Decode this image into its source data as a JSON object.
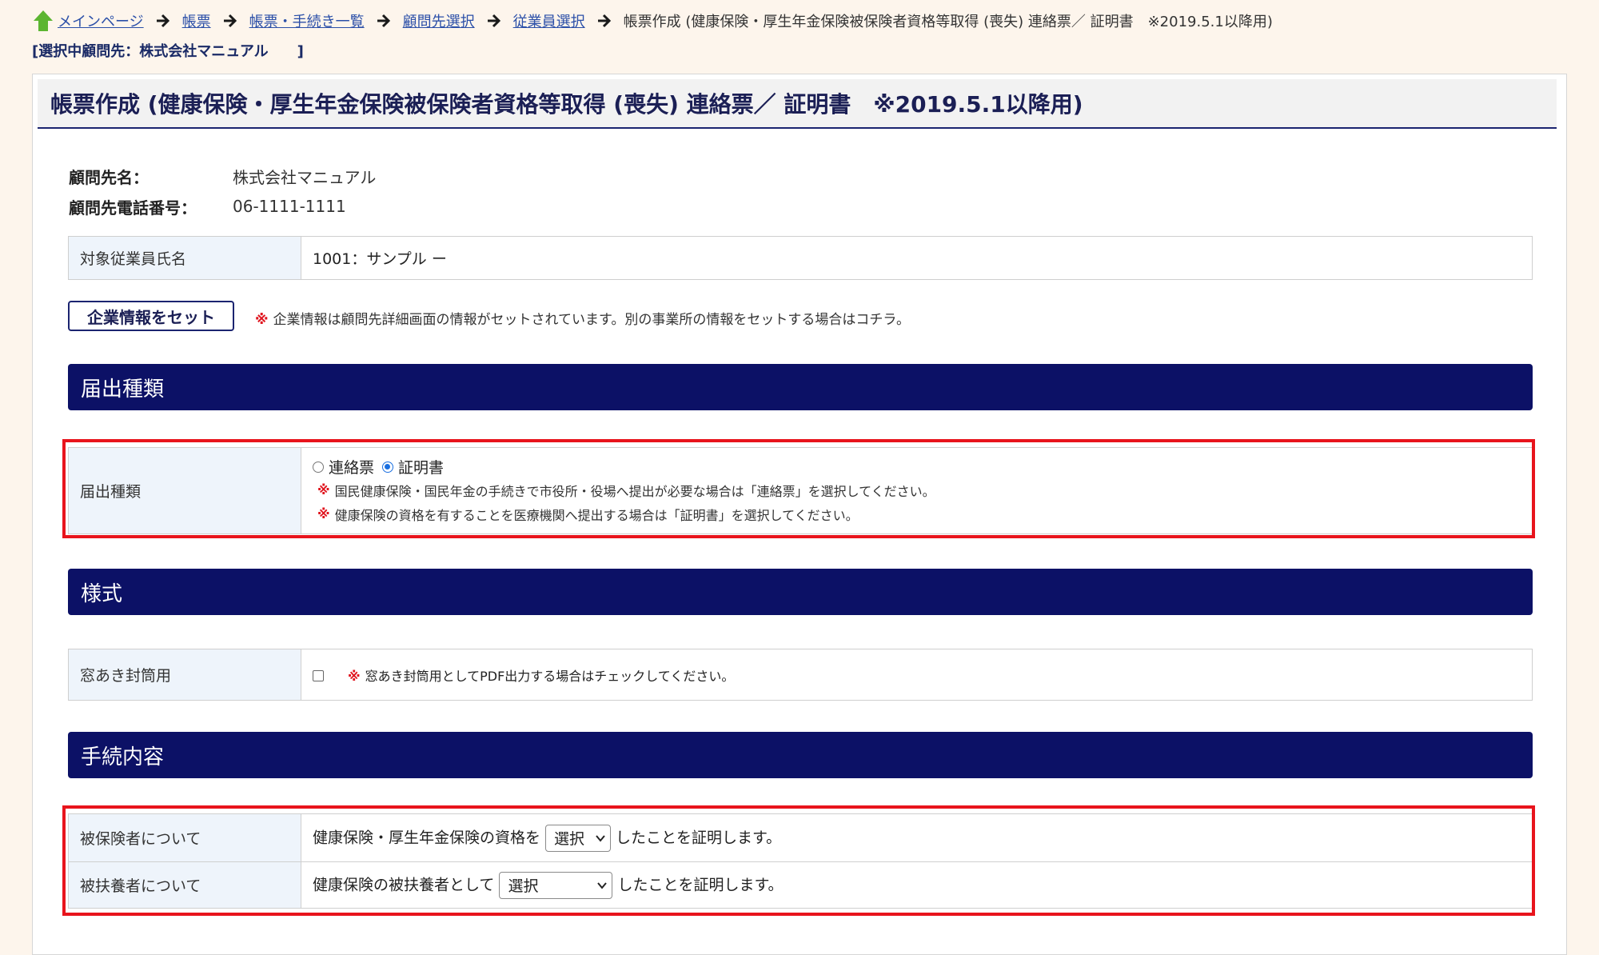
{
  "breadcrumb": {
    "items": [
      "メインページ",
      "帳票",
      "帳票・手続き一覧",
      "顧問先選択",
      "従業員選択"
    ],
    "current": "帳票作成 (健康保険・厚生年金保険被保険者資格等取得 (喪失) 連絡票／ 証明書　※2019.5.1以降用)"
  },
  "selected_client": "[選択中顧問先：株式会社マニュアル　　]",
  "page_title": "帳票作成 (健康保険・厚生年金保険被保険者資格等取得 (喪失) 連絡票／ 証明書　※2019.5.1以降用)",
  "client_info": {
    "name_label": "顧問先名：",
    "name_value": "株式会社マニュアル",
    "phone_label": "顧問先電話番号：",
    "phone_value": "06-1111-1111"
  },
  "employee": {
    "label": "対象従業員氏名",
    "value": "1001：サンプル ー"
  },
  "company_info": {
    "button_label": "企業情報をセット",
    "note_mark": "※",
    "note": "企業情報は顧問先詳細画面の情報がセットされています。別の事業所の情報をセットする場合はコチラ。"
  },
  "sections": {
    "notification_type": "届出種類",
    "format": "様式",
    "procedure": "手続内容"
  },
  "notification": {
    "label": "届出種類",
    "options": [
      "連絡票",
      "証明書"
    ],
    "selected": "証明書",
    "notes": [
      "国民健康保険・国民年金の手続きで市役所・役場へ提出が必要な場合は「連絡票」を選択してください。",
      "健康保険の資格を有することを医療機関へ提出する場合は「証明書」を選択してください。"
    ],
    "note_mark": "※"
  },
  "format": {
    "label": "窓あき封筒用",
    "checked": false,
    "note_mark": "※",
    "note": "窓あき封筒用としてPDF出力する場合はチェックしてください。"
  },
  "procedure": {
    "insured": {
      "label": "被保険者について",
      "prefix": "健康保険・厚生年金保険の資格を",
      "select_value": "選択",
      "suffix": "したことを証明します。"
    },
    "dependent": {
      "label": "被扶養者について",
      "prefix": "健康保険の被扶養者として",
      "select_value": "選択",
      "suffix": "したことを証明します。"
    }
  },
  "colors": {
    "background": "#fdf5ec",
    "section_bar": "#0c1166",
    "highlight_box": "#e8141c",
    "link": "#2b4fa8",
    "note_mark": "#e0141e",
    "label_cell": "#eef4fb"
  },
  "icons": {
    "home": "home-icon",
    "arrow": "arrow-right-icon",
    "select_chevron": "chevron-down-icon"
  }
}
